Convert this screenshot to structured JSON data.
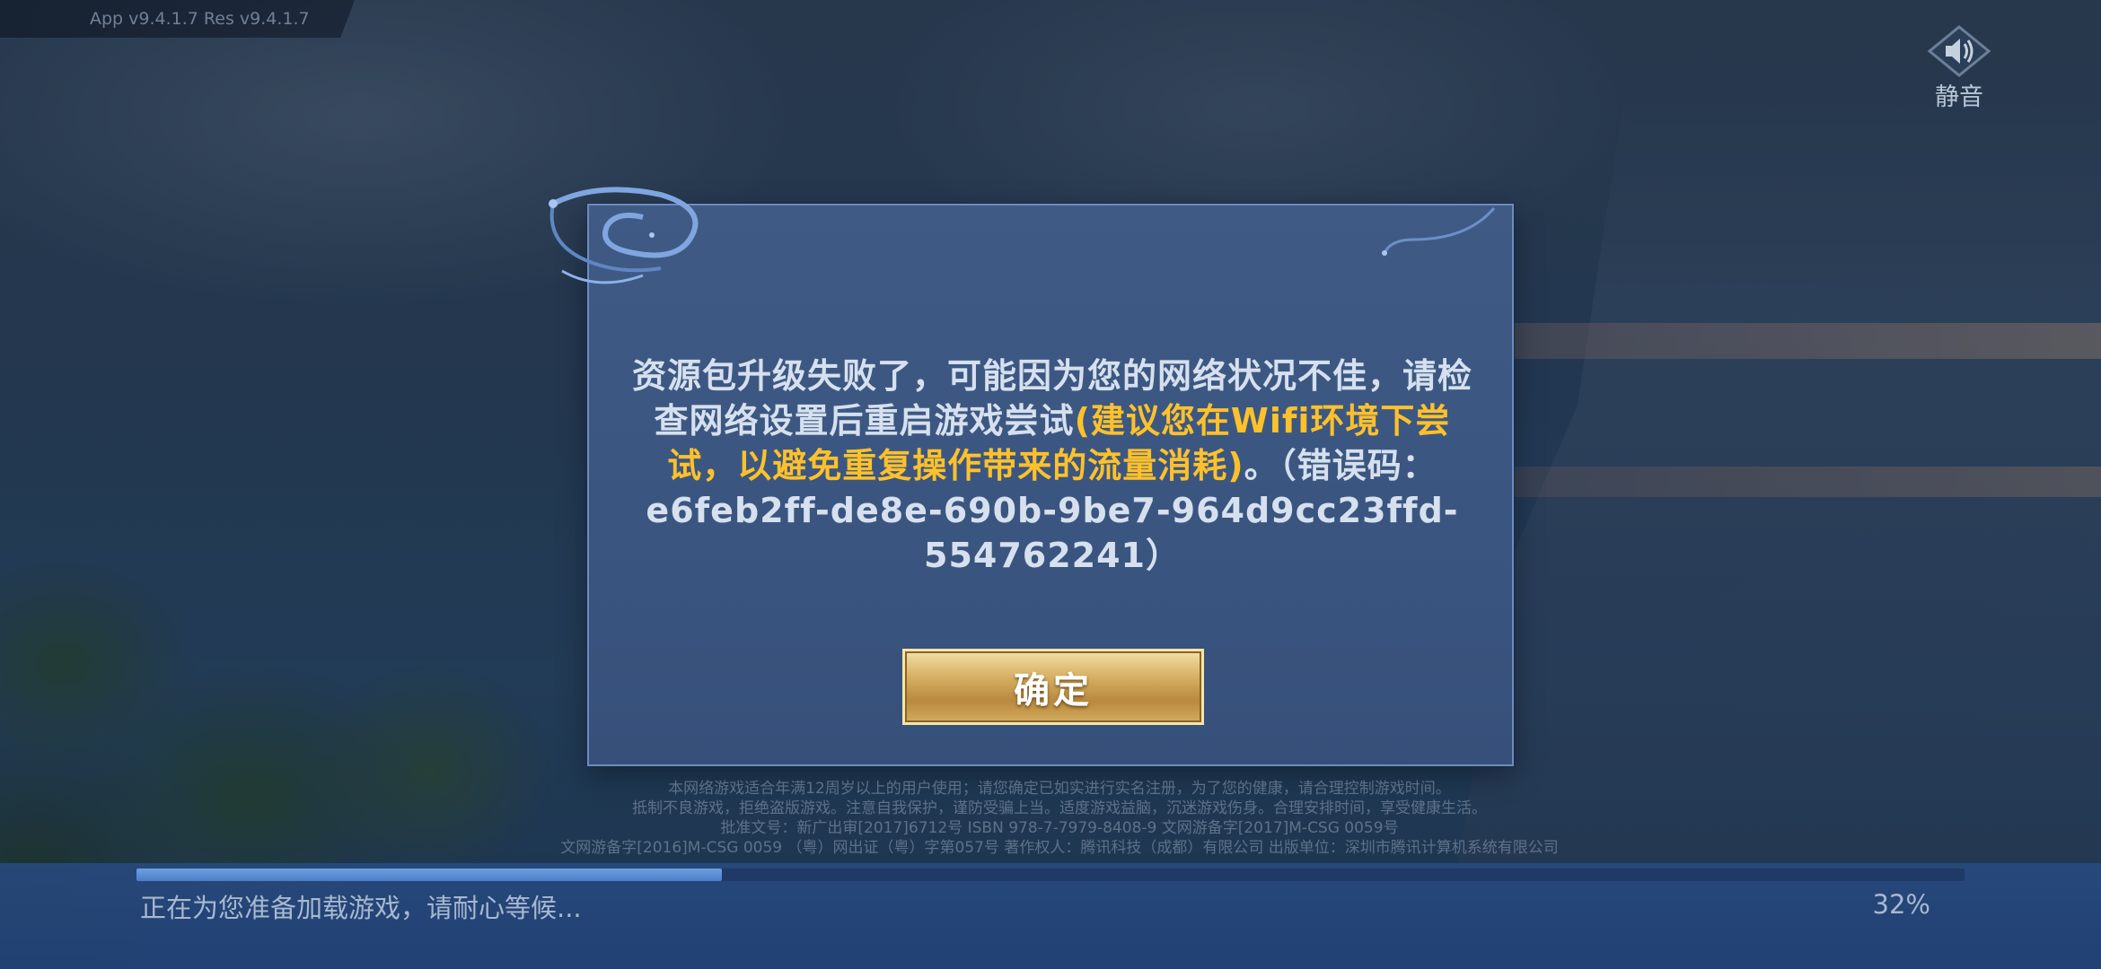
{
  "version": {
    "text": "App v9.4.1.7  Res v9.4.1.7"
  },
  "mute": {
    "label": "静音",
    "icon": "speaker-icon"
  },
  "dialog": {
    "message_part1": "资源包升级失败了，可能因为您的网络状况不佳，请检查网络设置后重启游戏尝试",
    "message_highlight": "(建议您在Wifi环境下尝试，以避免重复操作带来的流量消耗)",
    "message_part2": "。（错误码：e6feb2ff-de8e-690b-9be7-964d9cc23ffd-554762241）",
    "confirm_label": "确定"
  },
  "legal": {
    "lines": [
      "本网络游戏适合年满12周岁以上的用户使用；请您确定已如实进行实名注册，为了您的健康，请合理控制游戏时间。",
      "抵制不良游戏，拒绝盗版游戏。注意自我保护，谨防受骗上当。适度游戏益脑，沉迷游戏伤身。合理安排时间，享受健康生活。",
      "批准文号：新广出审[2017]6712号 ISBN 978-7-7979-8408-9 文网游备字[2017]M-CSG 0059号",
      "文网游备字[2016]M-CSG 0059 （粤）网出证（粤）字第057号 著作权人：腾讯科技（成都）有限公司 出版单位：深圳市腾讯计算机系统有限公司"
    ]
  },
  "loading": {
    "text": "正在为您准备加载游戏，请耐心等候...",
    "percent_label": "32%",
    "progress": 0.32
  },
  "colors": {
    "highlight": "#ffc12b",
    "dialog_bg": "#3b5781",
    "button_gold": "#d8b165"
  }
}
